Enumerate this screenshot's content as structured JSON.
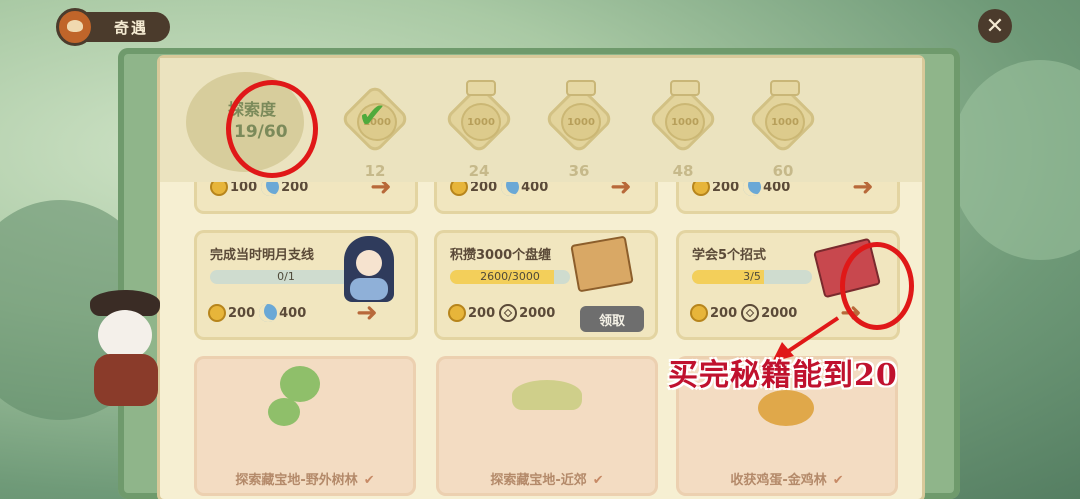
{
  "header": {
    "title": "奇遇"
  },
  "close_icon": "close-icon",
  "exploration": {
    "label": "探索度",
    "value": "19/60",
    "milestones": [
      {
        "number": "12",
        "reward": "1000",
        "claimed": true
      },
      {
        "number": "24",
        "reward": "1000",
        "claimed": false
      },
      {
        "number": "36",
        "reward": "1000",
        "claimed": false
      },
      {
        "number": "48",
        "reward": "1000",
        "claimed": false
      },
      {
        "number": "60",
        "reward": "1000",
        "claimed": false
      }
    ]
  },
  "top_row": [
    {
      "coin": "100",
      "moon": "200"
    },
    {
      "coin": "200",
      "moon": "400"
    },
    {
      "coin": "200",
      "moon": "400"
    }
  ],
  "tasks": [
    {
      "title": "完成当时明月支线",
      "progress": "0/1",
      "progress_fraction": 0,
      "coin": "200",
      "moon": "400"
    },
    {
      "title": "积攒3000个盘缠",
      "progress": "2600/3000",
      "progress_fraction": 0.867,
      "coin": "200",
      "cash": "2000",
      "claim_label": "领取"
    },
    {
      "title": "学会5个招式",
      "progress": "3/5",
      "progress_fraction": 0.6,
      "coin": "200",
      "cash": "2000"
    }
  ],
  "bottom_cards": [
    {
      "label": "探索藏宝地-野外树林"
    },
    {
      "label": "探索藏宝地-近郊"
    },
    {
      "label": "收获鸡蛋-金鸡林"
    }
  ],
  "annotation": {
    "text": "买完秘籍能到20",
    "color": "#c0112e"
  },
  "colors": {
    "accent": "#e01818",
    "coin": "#e7b53a",
    "check": "#4faa3c"
  }
}
